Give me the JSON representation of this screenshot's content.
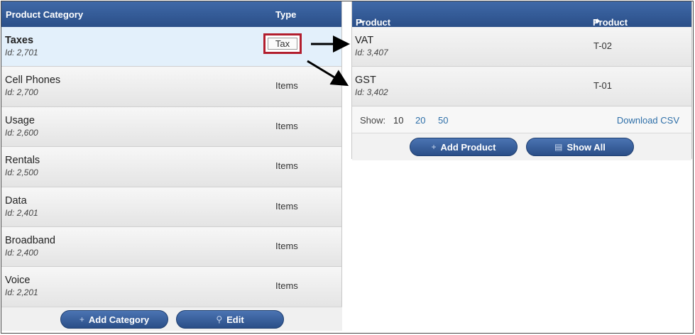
{
  "left_table": {
    "headers": {
      "category": "Product Category",
      "type": "Type"
    },
    "rows": [
      {
        "name": "Taxes",
        "id": "Id: 2,701",
        "type": "Tax",
        "selected": true
      },
      {
        "name": "Cell Phones",
        "id": "Id: 2,700",
        "type": "Items"
      },
      {
        "name": "Usage",
        "id": "Id: 2,600",
        "type": "Items"
      },
      {
        "name": "Rentals",
        "id": "Id: 2,500",
        "type": "Items"
      },
      {
        "name": "Data",
        "id": "Id: 2,401",
        "type": "Items"
      },
      {
        "name": "Broadband",
        "id": "Id: 2,400",
        "type": "Items"
      },
      {
        "name": "Voice",
        "id": "Id: 2,201",
        "type": "Items"
      }
    ],
    "buttons": {
      "add": "Add Category",
      "edit": "Edit"
    }
  },
  "right_table": {
    "headers": {
      "name": "Product Name",
      "number": "Product Number"
    },
    "rows": [
      {
        "name": "VAT",
        "id": "Id: 3,407",
        "number": "T-02"
      },
      {
        "name": "GST",
        "id": "Id: 3,402",
        "number": "T-01"
      }
    ],
    "show": {
      "label": "Show:",
      "options": [
        "10",
        "20",
        "50"
      ],
      "current": "10"
    },
    "download": "Download CSV",
    "buttons": {
      "add": "Add Product",
      "show_all": "Show All"
    }
  },
  "icons": {
    "plus": "plus-icon",
    "search": "search-icon",
    "list": "list-icon",
    "sort_asc": "sort-asc-icon",
    "sort_both": "sort-both-icon"
  },
  "colors": {
    "header": "#2f5590",
    "highlight_box": "#b21e2e",
    "selected_row": "#e3f0fb",
    "link": "#2e6fa8"
  }
}
